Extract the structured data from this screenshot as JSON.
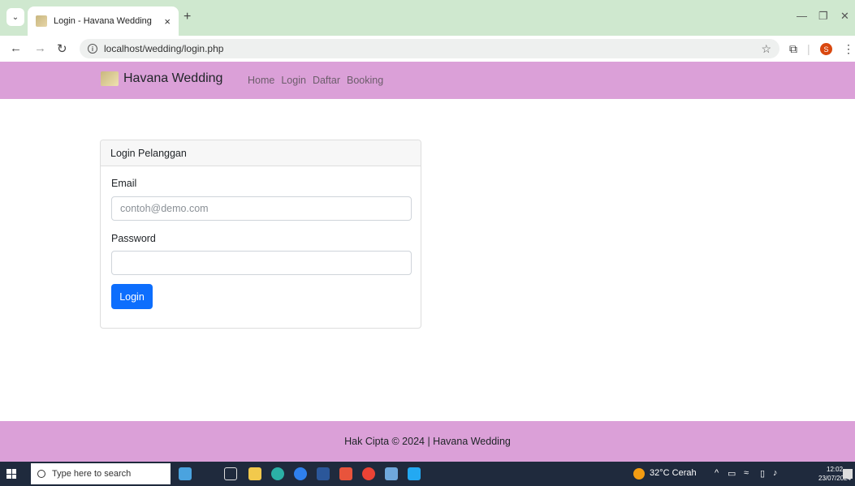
{
  "browser": {
    "tab_title": "Login - Havana Wedding",
    "tab_close": "×",
    "new_tab": "+",
    "url": "localhost/wedding/login.php",
    "profile_initial": "S"
  },
  "navbar": {
    "brand": "Havana Wedding",
    "links": [
      "Home",
      "Login",
      "Daftar",
      "Booking"
    ]
  },
  "login": {
    "header": "Login Pelanggan",
    "email_label": "Email",
    "email_placeholder": "contoh@demo.com",
    "email_value": "",
    "password_label": "Password",
    "password_value": "",
    "button": "Login"
  },
  "footer": {
    "text": "Hak Cipta © 2024 | Havana Wedding"
  },
  "taskbar": {
    "search_placeholder": "Type here to search",
    "weather": "32°C  Cerah",
    "time": "12:02",
    "date": "23/07/2024"
  },
  "colors": {
    "navbar_bg": "#dba0d8",
    "primary": "#0d6efd",
    "tabbar_bg": "#cfe8cf"
  }
}
